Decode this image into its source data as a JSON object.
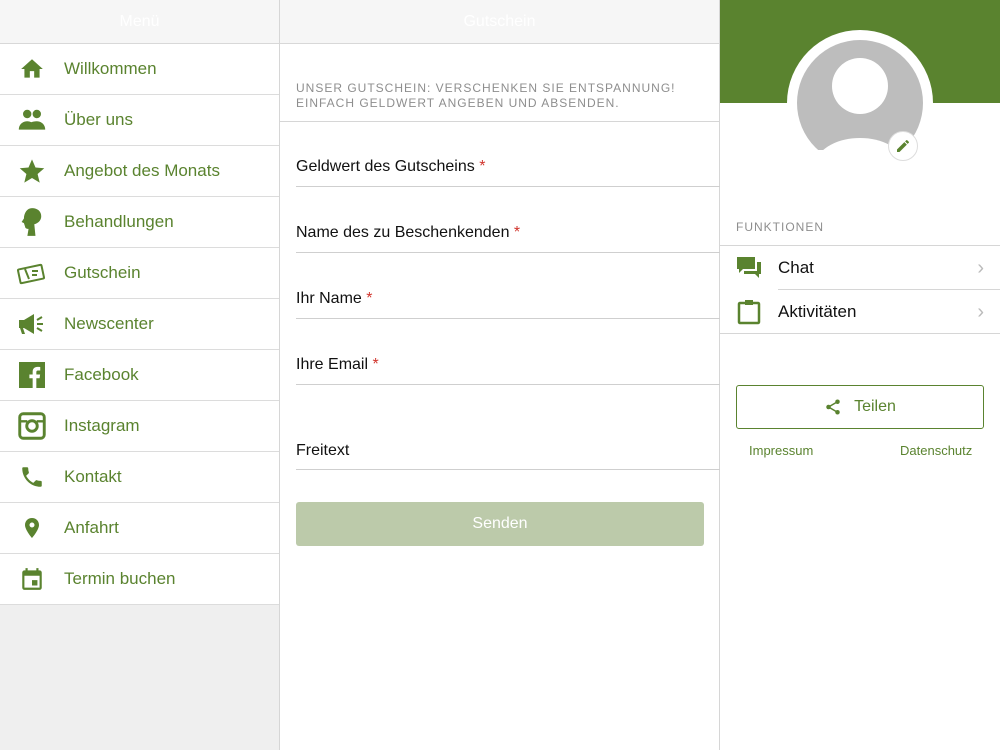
{
  "menu": {
    "title": "Menü",
    "items": [
      {
        "label": "Willkommen",
        "icon": "home-icon"
      },
      {
        "label": "Über uns",
        "icon": "people-icon"
      },
      {
        "label": "Angebot des Monats",
        "icon": "star-icon"
      },
      {
        "label": "Behandlungen",
        "icon": "face-profile-icon"
      },
      {
        "label": "Gutschein",
        "icon": "voucher-icon"
      },
      {
        "label": "Newscenter",
        "icon": "megaphone-icon"
      },
      {
        "label": "Facebook",
        "icon": "facebook-icon"
      },
      {
        "label": "Instagram",
        "icon": "instagram-icon"
      },
      {
        "label": "Kontakt",
        "icon": "phone-icon"
      },
      {
        "label": "Anfahrt",
        "icon": "location-pin-icon"
      },
      {
        "label": "Termin buchen",
        "icon": "calendar-icon"
      }
    ]
  },
  "form": {
    "title": "Gutschein",
    "intro_line1": "UNSER GUTSCHEIN: VERSCHENKEN SIE ENTSPANNUNG!",
    "intro_line2": "EINFACH GELDWERT ANGEBEN UND ABSENDEN.",
    "fields": [
      {
        "label": "Geldwert des Gutscheins",
        "required": "*"
      },
      {
        "label": "Name des zu Beschenkenden",
        "required": "*"
      },
      {
        "label": "Ihr Name",
        "required": "*"
      },
      {
        "label": "Ihre Email",
        "required": "*"
      },
      {
        "label": "Freitext"
      }
    ],
    "submit": "Senden"
  },
  "profile": {
    "section": "FUNKTIONEN",
    "items": [
      {
        "label": "Chat",
        "icon": "chat-icon"
      },
      {
        "label": "Aktivitäten",
        "icon": "clipboard-icon"
      }
    ],
    "share": "Teilen",
    "impressum": "Impressum",
    "datenschutz": "Datenschutz"
  },
  "colors": {
    "accent": "#5a832f",
    "button_disabled": "#bccaaa"
  }
}
